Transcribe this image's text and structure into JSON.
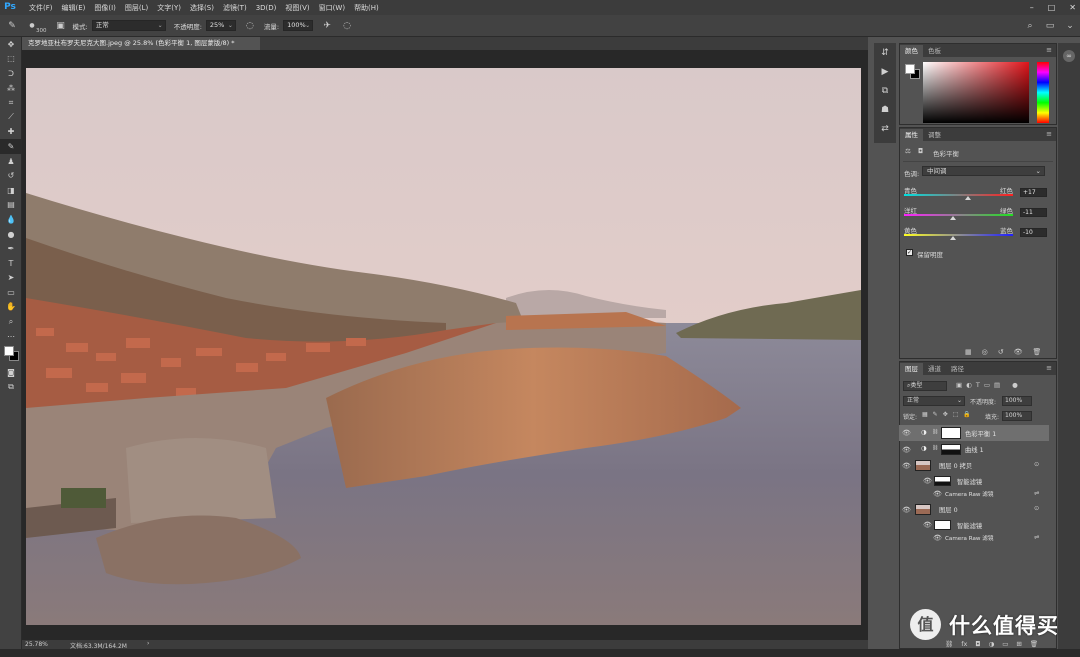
{
  "menu": {
    "logo": "Ps",
    "items": [
      "文件(F)",
      "编辑(E)",
      "图像(I)",
      "图层(L)",
      "文字(Y)",
      "选择(S)",
      "滤镜(T)",
      "3D(D)",
      "视图(V)",
      "窗口(W)",
      "帮助(H)"
    ]
  },
  "options": {
    "brush_size": "300",
    "mode_label": "模式:",
    "mode_value": "正常",
    "opacity_label": "不透明度:",
    "opacity_value": "25%",
    "flow_label": "流量:",
    "flow_value": "100%"
  },
  "document": {
    "tab_title": "克罗地亚杜布罗夫尼克大图.jpeg @ 25.8% (色彩平衡 1, 图层蒙版/8) *",
    "zoom": "25.78%",
    "doc_size": "文档:63.3M/164.2M"
  },
  "color_panel": {
    "tabs": [
      "颜色",
      "色板"
    ],
    "fg": "#ffffff",
    "bg": "#000000"
  },
  "properties": {
    "tabs": [
      "属性",
      "调整"
    ],
    "title": "色彩平衡",
    "tone_label": "色调:",
    "tone_value": "中间调",
    "sliders": [
      {
        "left": "青色",
        "right": "红色",
        "value": "+17",
        "pos": 0.585
      },
      {
        "left": "洋红",
        "right": "绿色",
        "value": "-11",
        "pos": 0.445
      },
      {
        "left": "黄色",
        "right": "蓝色",
        "value": "-10",
        "pos": 0.45
      }
    ],
    "preserve_label": "保留明度",
    "preserve_checked": true
  },
  "layers_panel": {
    "tabs": [
      "图层",
      "通道",
      "路径"
    ],
    "filter_value": "类型",
    "blend_mode": "正常",
    "opacity_label": "不透明度:",
    "opacity_value": "100%",
    "lock_label": "锁定:",
    "fill_label": "填充:",
    "fill_value": "100%",
    "layers": [
      {
        "name": "色彩平衡 1",
        "kind": "adjust",
        "selected": true
      },
      {
        "name": "曲线 1",
        "kind": "adjust",
        "selected": false
      },
      {
        "name": "图层 0 拷贝",
        "kind": "smart",
        "selected": false
      },
      {
        "name": "智能滤镜",
        "kind": "filter",
        "selected": false
      },
      {
        "name": "Camera Raw 滤镜",
        "kind": "sub",
        "selected": false
      },
      {
        "name": "图层 0",
        "kind": "smart",
        "selected": false
      },
      {
        "name": "智能滤镜",
        "kind": "filter",
        "selected": false
      },
      {
        "name": "Camera Raw 滤镜",
        "kind": "sub",
        "selected": false
      }
    ]
  },
  "watermark": {
    "text": "什么值得买",
    "mark": "值"
  }
}
